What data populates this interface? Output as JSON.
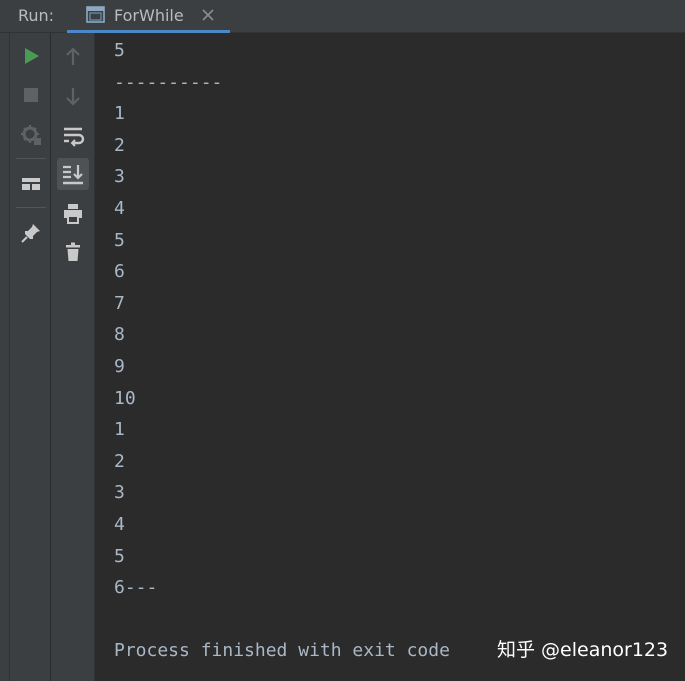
{
  "header": {
    "run_label": "Run:",
    "tab": {
      "title": "ForWhile"
    }
  },
  "toolbar_left": [
    {
      "name": "rerun-icon",
      "color": "#499c54"
    },
    {
      "name": "stop-icon",
      "color": "#5f6163"
    },
    {
      "name": "settings-debug-icon",
      "color": "#5f6163"
    },
    {
      "name": "layout-icon",
      "color": "#c9c9c9"
    },
    {
      "name": "pin-icon",
      "color": "#c9c9c9"
    }
  ],
  "toolbar_right": [
    {
      "name": "arrow-up-icon",
      "color": "#5f6163"
    },
    {
      "name": "arrow-down-icon",
      "color": "#5f6163"
    },
    {
      "name": "soft-wrap-icon",
      "color": "#c9c9c9"
    },
    {
      "name": "scroll-to-end-icon",
      "color": "#c9c9c9",
      "active": true
    },
    {
      "name": "print-icon",
      "color": "#c9c9c9"
    },
    {
      "name": "trash-icon",
      "color": "#c9c9c9"
    }
  ],
  "console": {
    "lines": [
      "5",
      "----------",
      "1",
      "2",
      "3",
      "4",
      "5",
      "6",
      "7",
      "8",
      "9",
      "10",
      "1",
      "2",
      "3",
      "4",
      "5",
      "6---",
      "",
      "Process finished with exit code"
    ],
    "watermark": "知乎 @eleanor123"
  },
  "colors": {
    "accent": "#4a88c7",
    "console_text": "#a9b7c6",
    "run_green": "#499c54"
  }
}
